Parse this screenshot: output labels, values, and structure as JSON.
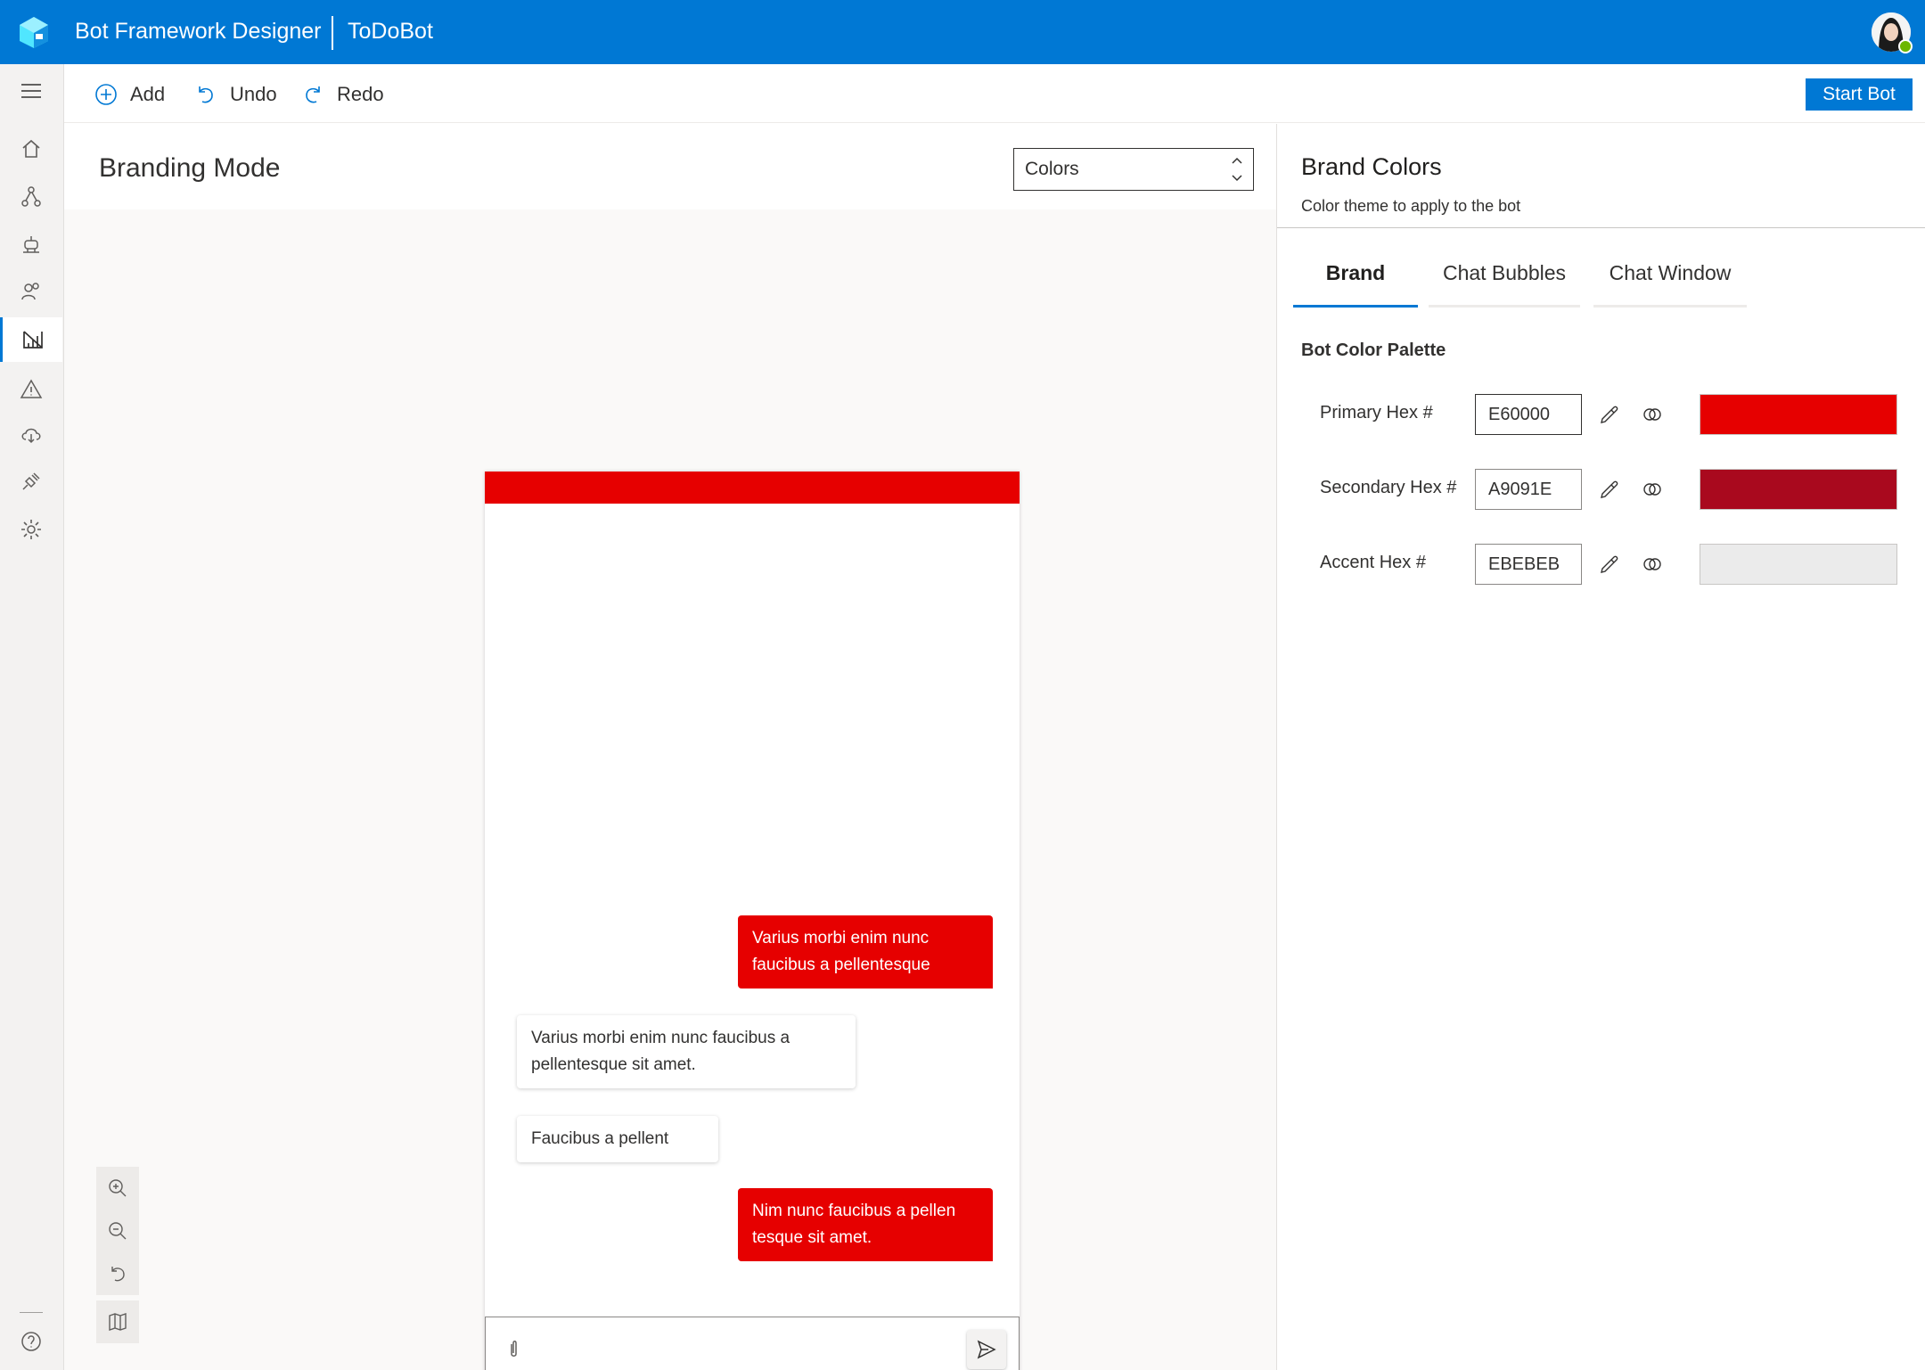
{
  "app": {
    "title": "Bot Framework Designer",
    "project": "ToDoBot"
  },
  "toolbar": {
    "add_label": "Add",
    "undo_label": "Undo",
    "redo_label": "Redo",
    "start_label": "Start Bot"
  },
  "nav": {
    "items": [
      {
        "icon": "home-icon",
        "active": false
      },
      {
        "icon": "flow-icon",
        "active": false
      },
      {
        "icon": "bot-icon",
        "active": false
      },
      {
        "icon": "users-icon",
        "active": false
      },
      {
        "icon": "branding-icon",
        "active": true
      },
      {
        "icon": "warning-icon",
        "active": false
      },
      {
        "icon": "cloud-icon",
        "active": false
      },
      {
        "icon": "plug-icon",
        "active": false
      },
      {
        "icon": "settings-icon",
        "active": false
      },
      {
        "icon": "help-icon",
        "active": false
      }
    ]
  },
  "main": {
    "title": "Branding Mode",
    "mode_select": "Colors"
  },
  "chat": {
    "messages": [
      {
        "from": "user",
        "text": "Varius morbi enim nunc faucibus a pellentesque"
      },
      {
        "from": "bot",
        "text": "Varius morbi enim nunc faucibus a pellentesque sit amet."
      },
      {
        "from": "bot",
        "text": "Faucibus a pellent"
      },
      {
        "from": "user",
        "text": "Nim nunc faucibus a pellen tesque sit amet."
      }
    ],
    "composer_placeholder": ""
  },
  "panel": {
    "title": "Brand Colors",
    "subtitle": "Color theme to apply to the bot",
    "tabs": [
      {
        "label": "Brand",
        "active": true
      },
      {
        "label": "Chat Bubbles",
        "active": false
      },
      {
        "label": "Chat Window",
        "active": false
      }
    ],
    "section_label": "Bot Color Palette",
    "colors": [
      {
        "label": "Primary Hex #",
        "value": "E60000",
        "swatch": "#e60000"
      },
      {
        "label": "Secondary Hex #",
        "value": "A9091E",
        "swatch": "#a9091e"
      },
      {
        "label": "Accent Hex #",
        "value": "EBEBEB",
        "swatch": "#ebebeb"
      }
    ]
  }
}
